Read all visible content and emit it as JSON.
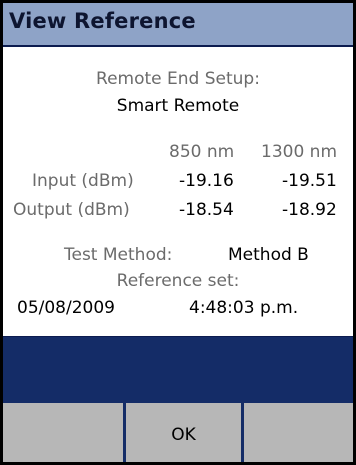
{
  "window": {
    "title": "View Reference"
  },
  "reference": {
    "remote_end_setup_label": "Remote End Setup:",
    "remote_end_setup_value": "Smart Remote",
    "wavelength_headers": [
      "850 nm",
      "1300 nm"
    ],
    "input_label": "Input (dBm)",
    "input_values": [
      "-19.16",
      "-19.51"
    ],
    "output_label": "Output (dBm)",
    "output_values": [
      "-18.54",
      "-18.92"
    ],
    "test_method_label": "Test Method:",
    "test_method_value": "Method B",
    "reference_set_label": "Reference set:",
    "reference_date": "05/08/2009",
    "reference_time": "4:48:03 p.m."
  },
  "softkeys": {
    "left_label": "",
    "ok_label": "OK",
    "right_label": ""
  },
  "colors": {
    "title_bar": "#8ea3c7",
    "blue_bar": "#142c67",
    "softkey_bg": "#b7b7b7",
    "label_gray": "#6b6b6b"
  }
}
